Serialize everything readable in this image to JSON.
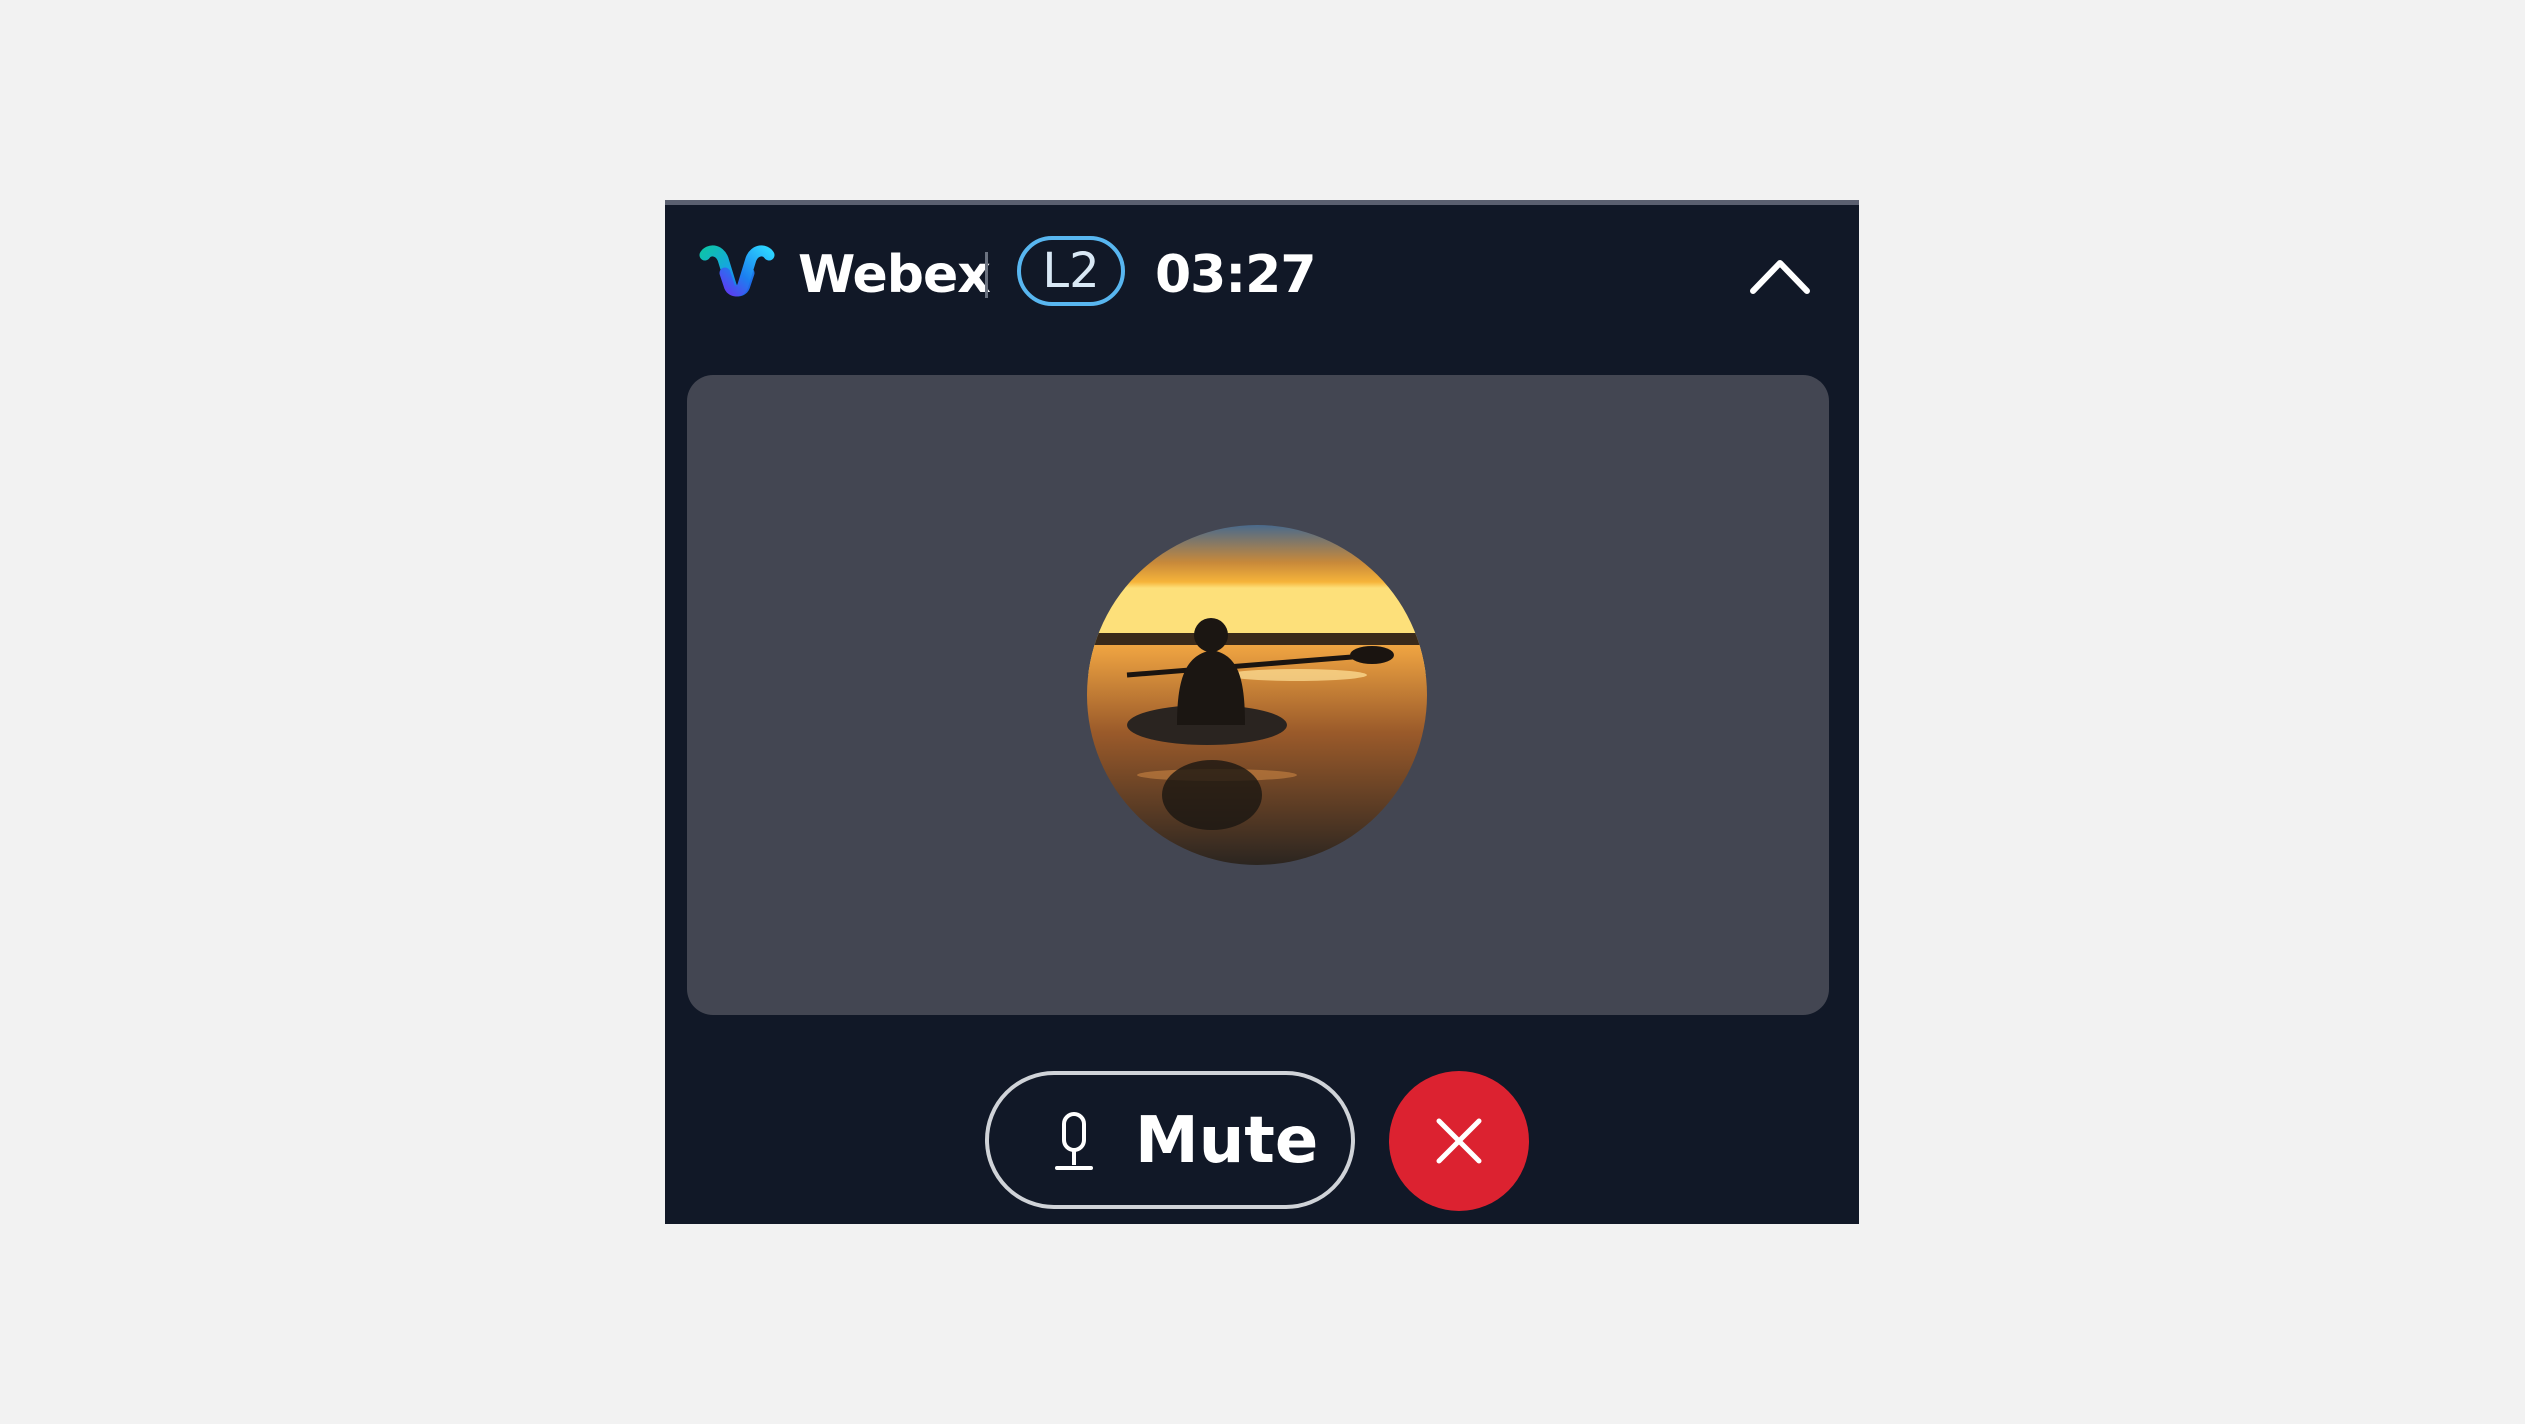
{
  "header": {
    "app_name": "Webex",
    "lock_badge": "L2",
    "timer": "03:27",
    "logo_icon": "webex-logo",
    "collapse_icon": "chevron-up-icon"
  },
  "tile": {
    "avatar_icon": "avatar"
  },
  "controls": {
    "mute_label": "Mute",
    "mute_icon": "microphone-icon",
    "end_icon": "close-icon",
    "end_color": "#dc2230"
  },
  "colors": {
    "background": "#111827",
    "tile": "#434652",
    "badge_border": "#58b6f0"
  }
}
